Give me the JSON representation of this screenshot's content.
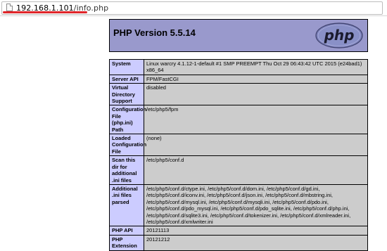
{
  "browser": {
    "url_host": "192.168.1.101",
    "url_path": "/info.php",
    "accent_underline": "#e0262a",
    "page_icon": "document-icon"
  },
  "phpinfo": {
    "title": "PHP Version 5.5.14",
    "logo_text": "php",
    "colors": {
      "header": "#9999cc",
      "key_cell": "#ccccff",
      "value_cell": "#cccccc"
    },
    "rows": [
      {
        "key": "System",
        "value": "Linux warcry 4.1.12-1-default #1 SMP PREEMPT Thu Oct 29 06:43:42 UTC 2015 (e24bad1) x86_64"
      },
      {
        "key": "Server API",
        "value": "FPM/FastCGI"
      },
      {
        "key": "Virtual Directory Support",
        "value": "disabled"
      },
      {
        "key": "Configuration File (php.ini) Path",
        "value": "/etc/php5/fpm"
      },
      {
        "key": "Loaded Configuration File",
        "value": "(none)"
      },
      {
        "key": "Scan this dir for additional .ini files",
        "value": "/etc/php5/conf.d"
      },
      {
        "key": "Additional .ini files parsed",
        "value": "/etc/php5/conf.d/ctype.ini, /etc/php5/conf.d/dom.ini, /etc/php5/conf.d/gd.ini, /etc/php5/conf.d/iconv.ini, /etc/php5/conf.d/json.ini, /etc/php5/conf.d/mbstring.ini, /etc/php5/conf.d/mysql.ini, /etc/php5/conf.d/mysqli.ini, /etc/php5/conf.d/pdo.ini, /etc/php5/conf.d/pdo_mysql.ini, /etc/php5/conf.d/pdo_sqlite.ini, /etc/php5/conf.d/php.ini, /etc/php5/conf.d/sqlite3.ini, /etc/php5/conf.d/tokenizer.ini, /etc/php5/conf.d/xmlreader.ini, /etc/php5/conf.d/xmlwriter.ini"
      },
      {
        "key": "PHP API",
        "value": "20121113"
      },
      {
        "key": "PHP Extension",
        "value": "20121212"
      }
    ]
  }
}
